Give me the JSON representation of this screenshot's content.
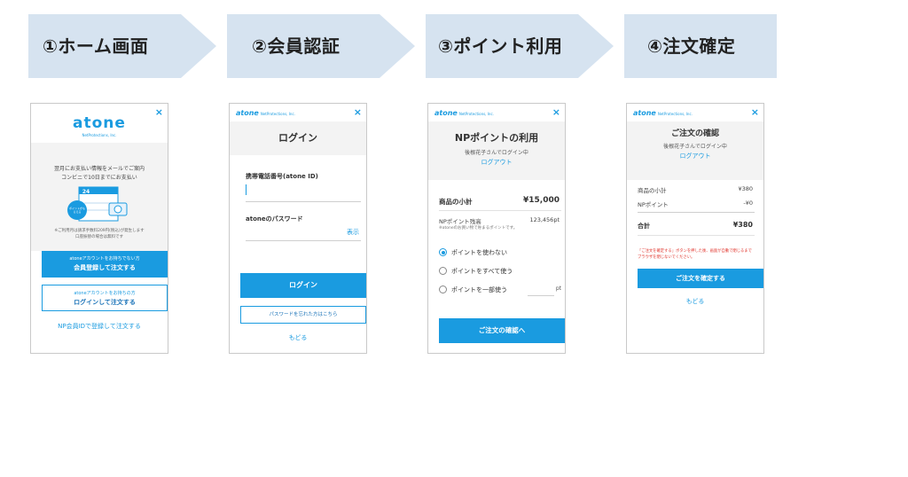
{
  "steps": [
    {
      "label": "①ホーム画面"
    },
    {
      "label": "②会員認証"
    },
    {
      "label": "③ポイント利用"
    },
    {
      "label": "④注文確定"
    }
  ],
  "colors": {
    "step_fill": "#d6e3f0",
    "accent": "#1a9be0",
    "error": "#e0322a"
  },
  "panel1": {
    "logo": "atone",
    "logo_sub": "NetProtections, Inc.",
    "close": "×",
    "intro_1": "翌月にお支払い情報をメールでご案内",
    "intro_2": "コンビニで10日までにお支払い",
    "calendar_day": "24",
    "badge": "ポイントがもらえる",
    "note_1": "※ご利用月は請求手数料209円(税込)が発生します",
    "note_2": "口座振替の場合は無料です",
    "register_small": "atoneアカウントをお持ちでない方",
    "register_label": "会員登録して注文する",
    "login_small": "atoneアカウントをお持ちの方",
    "login_label": "ログインして注文する",
    "np_link": "NP会員IDで登録して注文する"
  },
  "panel2": {
    "logo": "atone",
    "logo_sub": "NetProtections, Inc.",
    "close": "×",
    "title": "ログイン",
    "phone_label": "携帯電話番号(atone ID)",
    "password_label": "atoneのパスワード",
    "show_label": "表示",
    "login_button": "ログイン",
    "forgot_button": "パスワードを忘れた方はこちら",
    "back": "もどる"
  },
  "panel3": {
    "logo": "atone",
    "logo_sub": "NetProtections, Inc.",
    "close": "×",
    "title": "NPポイントの利用",
    "user_status": "後根花子さんでログイン中",
    "logout": "ログアウト",
    "subtotal_label": "商品の小計",
    "subtotal_value": "¥15,000",
    "points_label": "NPポイント残高",
    "points_value": "123,456pt",
    "points_note": "※atoneのお買い物で貯まるポイントです。",
    "options": [
      "ポイントを使わない",
      "ポイントをすべて使う",
      "ポイントを一部使う"
    ],
    "selected_option": 0,
    "pt_unit": "pt",
    "confirm_button": "ご注文の確認へ"
  },
  "panel4": {
    "logo": "atone",
    "logo_sub": "NetProtections, Inc.",
    "close": "×",
    "title": "ご注文の確認",
    "user_status": "後根花子さんでログイン中",
    "logout": "ログアウト",
    "subtotal_label": "商品の小計",
    "subtotal_value": "¥380",
    "points_label": "NPポイント",
    "points_value": "-¥0",
    "total_label": "合計",
    "total_value": "¥380",
    "warning_1": "「ご注文を確定する」ボタンを押した後、画面が自動で閉じるまで",
    "warning_2": "ブラウザを閉じないでください。",
    "confirm_button": "ご注文を確定する",
    "back": "もどる"
  }
}
